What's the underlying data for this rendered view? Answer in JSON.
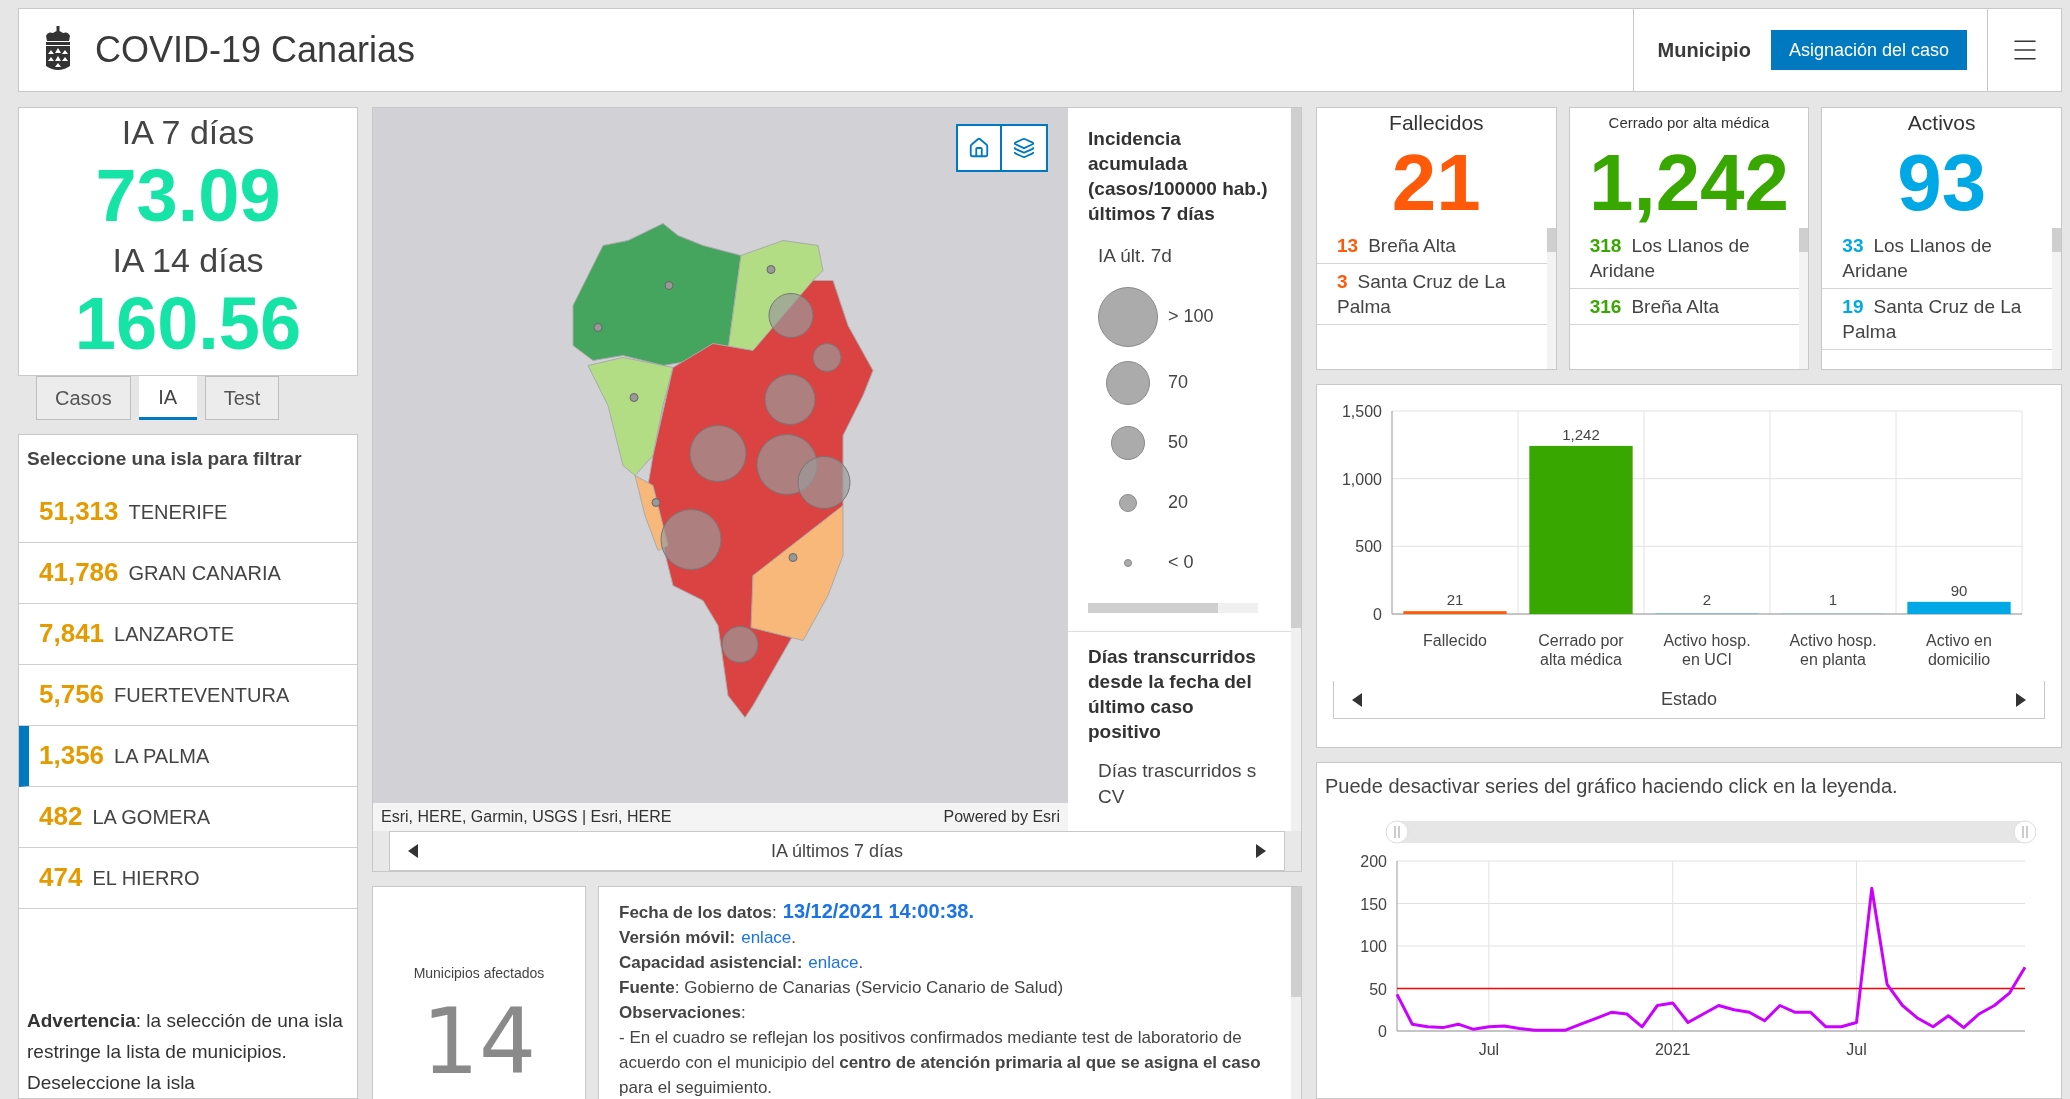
{
  "header": {
    "title": "COVID-19 Canarias",
    "tabs": [
      {
        "label": "Municipio",
        "selected": false
      },
      {
        "label": "Asignación del caso",
        "selected": true
      }
    ]
  },
  "ia_card": {
    "label_7": "IA 7 días",
    "value_7": "73.09",
    "label_14": "IA 14 días",
    "value_14": "160.56"
  },
  "ia_tabs": [
    {
      "label": "Casos",
      "selected": false
    },
    {
      "label": "IA",
      "selected": true
    },
    {
      "label": "Test",
      "selected": false
    }
  ],
  "islands": {
    "heading": "Seleccione una isla para filtrar",
    "items": [
      {
        "count": "51,313",
        "name": "TENERIFE",
        "selected": false
      },
      {
        "count": "41,786",
        "name": "GRAN CANARIA",
        "selected": false
      },
      {
        "count": "7,841",
        "name": "LANZAROTE",
        "selected": false
      },
      {
        "count": "5,756",
        "name": "FUERTEVENTURA",
        "selected": false
      },
      {
        "count": "1,356",
        "name": "LA PALMA",
        "selected": true
      },
      {
        "count": "482",
        "name": "LA GOMERA",
        "selected": false
      },
      {
        "count": "474",
        "name": "EL HIERRO",
        "selected": false
      }
    ],
    "warning": "**Advertencia**: la selección de una isla restringe la lista de municipios. Deseleccione la isla"
  },
  "map": {
    "attribution": "Esri, HERE, Garmin, USGS | Esri, HERE",
    "powered_by": "Powered by Esri",
    "nav_label": "IA últimos 7 días"
  },
  "legend": {
    "title": "Incidencia acumulada (casos/100000 hab.) últimos 7 días",
    "subtitle": "IA últ. 7d",
    "items": [
      "> 100",
      "70",
      "50",
      "20",
      "< 0"
    ],
    "second_title": "Días transcurridos desde la fecha del último caso positivo",
    "second_lines": [
      "Días trascurridos s",
      "CV"
    ]
  },
  "affected": {
    "label": "Municipios afectados",
    "value": "14"
  },
  "info": {
    "lines": [
      {
        "kind": "date",
        "label": "**Fecha de los datos**:",
        "value": "13/12/2021 14:00:38."
      },
      {
        "kind": "link",
        "label": "**Versión móvil:**",
        "link": "enlace",
        "suffix": "."
      },
      {
        "kind": "link",
        "label": "**Capacidad asistencial:**",
        "link": "enlace",
        "suffix": "."
      },
      {
        "kind": "text",
        "text": "**Fuente**: Gobierno de Canarias (Servicio Canario de Salud)"
      },
      {
        "kind": "text",
        "text": "**Observaciones**:"
      },
      {
        "kind": "text",
        "text": "- En el cuadro se reflejan los positivos confirmados mediante test de laboratorio de acuerdo con el municipio del **centro de atención primaria al que se asigna el caso** para el seguimiento."
      }
    ]
  },
  "cards": [
    {
      "title": "Fallecidos",
      "value": "21",
      "color": "#ff5a0a",
      "items": [
        {
          "count": "13",
          "name": "Breña Alta"
        },
        {
          "count": "3",
          "name": "Santa Cruz de La Palma"
        }
      ]
    },
    {
      "title": "Cerrado por alta médica",
      "value": "1,242",
      "color": "#38a800",
      "items": [
        {
          "count": "318",
          "name": "Los Llanos de Aridane"
        },
        {
          "count": "316",
          "name": "Breña Alta"
        }
      ]
    },
    {
      "title": "Activos",
      "value": "93",
      "color": "#00a9e6",
      "items": [
        {
          "count": "33",
          "name": "Los Llanos de Aridane"
        },
        {
          "count": "19",
          "name": "Santa Cruz de La Palma"
        }
      ]
    }
  ],
  "status_chart": {
    "chart_data": {
      "type": "bar",
      "xlabel": "Estado",
      "categories": [
        "Fallecido",
        "Cerrado por alta médica",
        "Activo hosp. en UCI",
        "Activo hosp. en planta",
        "Activo en domicilio"
      ],
      "values": [
        21,
        1242,
        2,
        1,
        90
      ],
      "grid": true,
      "colors": [
        "#ff5a0a",
        "#38a800",
        "#00a9e6",
        "#00a9e6",
        "#00a9e6"
      ],
      "ylim": [
        0,
        1500
      ],
      "yticks": [
        {
          "value": 0,
          "label": "0"
        },
        {
          "value": 500,
          "label": "500"
        },
        {
          "value": 1000,
          "label": "1,000"
        },
        {
          "value": 1500,
          "label": "1,500"
        }
      ],
      "value_labels": [
        "21",
        "1,242",
        "2",
        "1",
        "90"
      ]
    }
  },
  "trend_chart": {
    "note": "Puede desactivar series del gráfico haciendo click en la leyenda.",
    "chart_data": {
      "type": "line",
      "categories": [
        null,
        null,
        null,
        null,
        null,
        null,
        "Jul",
        null,
        null,
        null,
        null,
        null,
        null,
        null,
        null,
        null,
        null,
        null,
        "2021",
        null,
        null,
        null,
        null,
        null,
        null,
        null,
        null,
        null,
        null,
        null,
        "Jul",
        null,
        null,
        null,
        null,
        null,
        null,
        null,
        null,
        null,
        null,
        null
      ],
      "values": [
        43,
        8,
        5,
        4,
        8,
        2,
        5,
        6,
        3,
        1,
        1,
        1,
        8,
        15,
        22,
        20,
        5,
        30,
        33,
        10,
        20,
        30,
        25,
        22,
        12,
        30,
        22,
        22,
        5,
        5,
        10,
        168,
        55,
        30,
        15,
        5,
        18,
        4,
        20,
        30,
        45,
        75
      ],
      "ylim": [
        0,
        200
      ],
      "yticks": [
        0,
        50,
        100,
        150,
        200
      ],
      "grid": true,
      "ref_lines": [
        {
          "axis": "y",
          "value": 50,
          "color": "#ff0000"
        }
      ]
    }
  }
}
